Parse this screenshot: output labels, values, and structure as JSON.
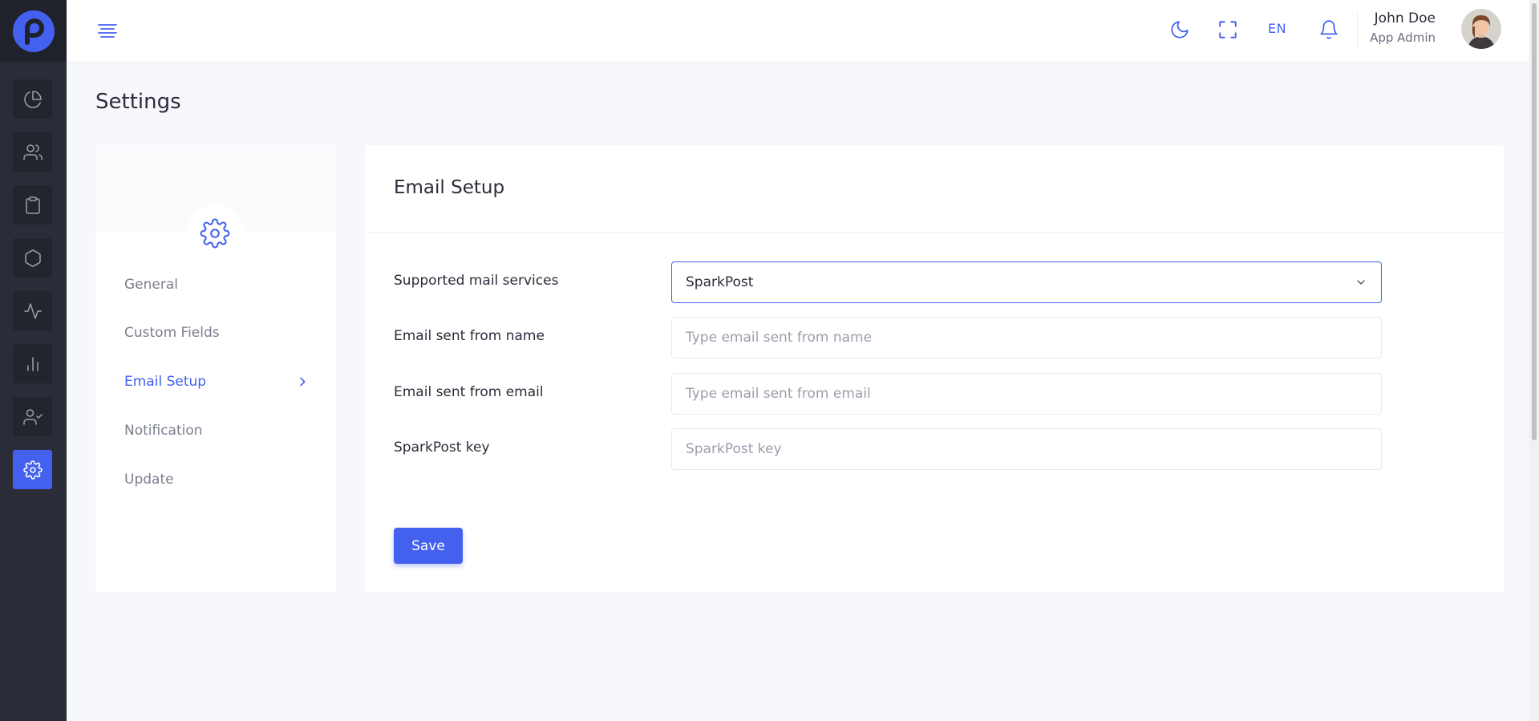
{
  "colors": {
    "accent": "#4361ee",
    "sidebar_bg": "#2a2d38",
    "page_bg": "#f7f8fc"
  },
  "header": {
    "language": "EN",
    "user": {
      "name": "John Doe",
      "role": "App Admin"
    },
    "icons": [
      "menu-icon",
      "moon-icon",
      "fullscreen-icon",
      "bell-icon"
    ]
  },
  "sidebar": {
    "items": [
      {
        "icon": "pie-chart-icon",
        "active": false
      },
      {
        "icon": "users-icon",
        "active": false
      },
      {
        "icon": "clipboard-icon",
        "active": false
      },
      {
        "icon": "hexagon-icon",
        "active": false
      },
      {
        "icon": "activity-icon",
        "active": false
      },
      {
        "icon": "bar-chart-icon",
        "active": false
      },
      {
        "icon": "user-check-icon",
        "active": false
      },
      {
        "icon": "settings-icon",
        "active": true
      }
    ]
  },
  "page": {
    "title": "Settings"
  },
  "settings_nav": {
    "items": [
      {
        "label": "General",
        "active": false
      },
      {
        "label": "Custom Fields",
        "active": false
      },
      {
        "label": "Email Setup",
        "active": true
      },
      {
        "label": "Notification",
        "active": false
      },
      {
        "label": "Update",
        "active": false
      }
    ]
  },
  "email_setup": {
    "title": "Email Setup",
    "fields": {
      "mail_service": {
        "label": "Supported mail services",
        "value": "SparkPost"
      },
      "from_name": {
        "label": "Email sent from name",
        "placeholder": "Type email sent from name",
        "value": ""
      },
      "from_email": {
        "label": "Email sent from email",
        "placeholder": "Type email sent from email",
        "value": ""
      },
      "sparkpost_key": {
        "label": "SparkPost key",
        "placeholder": "SparkPost key",
        "value": ""
      }
    },
    "save_label": "Save"
  }
}
